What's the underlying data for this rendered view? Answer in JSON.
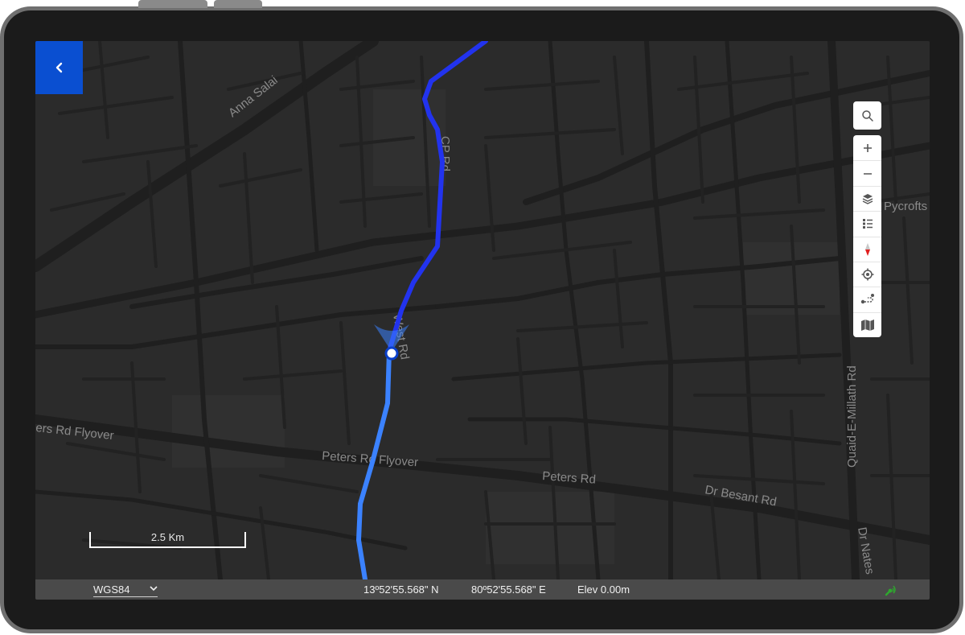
{
  "map": {
    "labels": {
      "anna_salai": "Anna Salai",
      "cp_rd": "CP Rd",
      "west_rd": "West Rd",
      "peters_rd_flyover_left": "ers Rd Flyover",
      "peters_rd_flyover": "Peters Rd Flyover",
      "peters_rd": "Peters Rd",
      "dr_besant_rd": "Dr Besant Rd",
      "pycrofts": "Pycrofts",
      "quaid_e_millath_rd": "Quaid-E-Millath Rd",
      "dr_nates": "Dr Nates"
    },
    "route_color": "#2e5bff",
    "location_marker_color": "#0a3fc9"
  },
  "scale": {
    "label": "2.5 Km"
  },
  "toolbar": {
    "search": "search-icon",
    "items": [
      "zoom-in-icon",
      "zoom-out-icon",
      "layers-icon",
      "legend-list-icon",
      "compass-icon",
      "locate-icon",
      "route-icon",
      "map-icon"
    ]
  },
  "status": {
    "crs": "WGS84",
    "latitude": "13º52'55.568\" N",
    "longitude": "80º52'55.568\" E",
    "elevation": "Elev 0.00m",
    "gps_color": "#2ea82e"
  },
  "colors": {
    "accent": "#0a4fd1",
    "map_bg": "#2b2b2b",
    "road": "#1f1f1f",
    "statusbar": "#4a4a4a"
  }
}
